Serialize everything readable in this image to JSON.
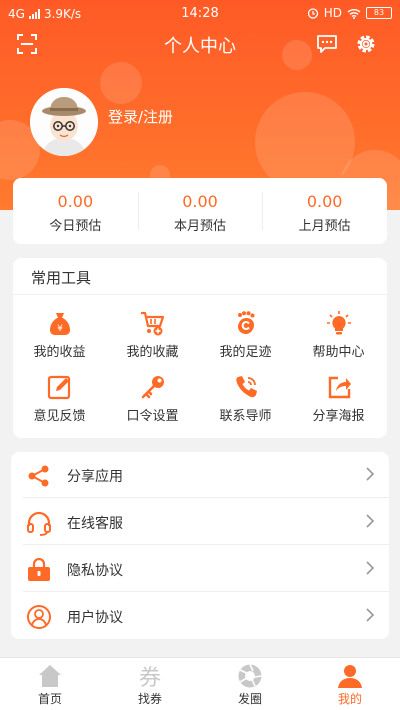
{
  "status_bar": {
    "network": "4G",
    "speed": "3.9K/s",
    "time": "14:28",
    "hd": "HD",
    "battery": "83"
  },
  "header": {
    "title": "个人中心",
    "login_text": "登录/注册"
  },
  "stats": [
    {
      "value": "0.00",
      "label": "今日预估"
    },
    {
      "value": "0.00",
      "label": "本月预估"
    },
    {
      "value": "0.00",
      "label": "上月预估"
    }
  ],
  "tools": {
    "title": "常用工具",
    "items": [
      {
        "label": "我的收益",
        "icon": "money-bag-icon"
      },
      {
        "label": "我的收藏",
        "icon": "cart-icon"
      },
      {
        "label": "我的足迹",
        "icon": "footprint-icon"
      },
      {
        "label": "帮助中心",
        "icon": "lightbulb-icon"
      },
      {
        "label": "意见反馈",
        "icon": "edit-icon"
      },
      {
        "label": "口令设置",
        "icon": "key-icon"
      },
      {
        "label": "联系导师",
        "icon": "phone-icon"
      },
      {
        "label": "分享海报",
        "icon": "share-poster-icon"
      }
    ]
  },
  "menu": [
    {
      "label": "分享应用",
      "icon": "share-icon"
    },
    {
      "label": "在线客服",
      "icon": "headset-icon"
    },
    {
      "label": "隐私协议",
      "icon": "lock-icon"
    },
    {
      "label": "用户协议",
      "icon": "user-icon"
    }
  ],
  "tabbar": [
    {
      "label": "首页",
      "icon": "home-icon",
      "active": false
    },
    {
      "label": "找券",
      "icon": "coupon-icon",
      "glyph": "券",
      "active": false
    },
    {
      "label": "发圈",
      "icon": "aperture-icon",
      "active": false
    },
    {
      "label": "我的",
      "icon": "person-icon",
      "active": true
    }
  ],
  "colors": {
    "accent": "#ff6a26",
    "header_top": "#ff5a26",
    "header_bottom": "#ff7a2e",
    "inactive_icon": "#c8c8c8"
  }
}
